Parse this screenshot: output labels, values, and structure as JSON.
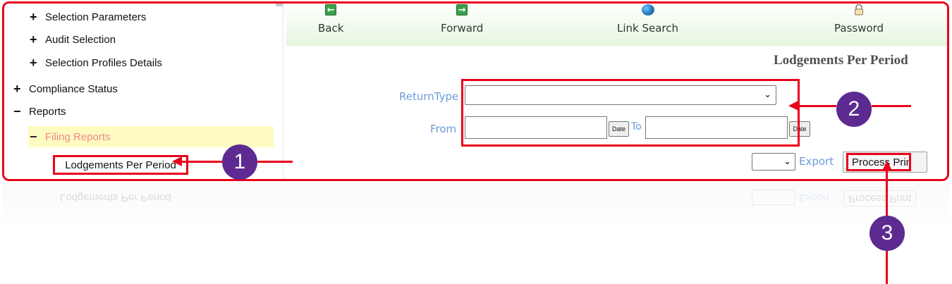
{
  "sidebar": {
    "items": [
      {
        "sign": "+",
        "label": "Selection Parameters"
      },
      {
        "sign": "+",
        "label": "Audit Selection"
      },
      {
        "sign": "+",
        "label": "Selection Profiles Details"
      },
      {
        "sign": "+",
        "label": "Compliance Status"
      },
      {
        "sign": "−",
        "label": "Reports"
      },
      {
        "sign": "−",
        "label": "Filing Reports"
      },
      {
        "sign": "",
        "label": "Lodgements Per Period"
      }
    ]
  },
  "toolbar": {
    "back": "Back",
    "forward": "Forward",
    "link_search": "Link Search",
    "password": "Password"
  },
  "page": {
    "heading": "Lodgements Per Period"
  },
  "form": {
    "return_type_label": "ReturnType",
    "return_type_value": "",
    "from_label": "From",
    "from_value": "",
    "to_label": "To",
    "to_value": "",
    "date_button": "Date"
  },
  "actions": {
    "export_value": "",
    "export_label": "Export",
    "process_print": "Process Print"
  },
  "callouts": {
    "one": "1",
    "two": "2",
    "three": "3"
  },
  "colors": {
    "highlight_red": "#e8001c",
    "callout_purple": "#5c2a91",
    "label_blue": "#6b9bd8",
    "toolbar_green": "#e6f6df",
    "selected_yellow": "#fdfbc0",
    "selected_text": "#f08a8a"
  }
}
